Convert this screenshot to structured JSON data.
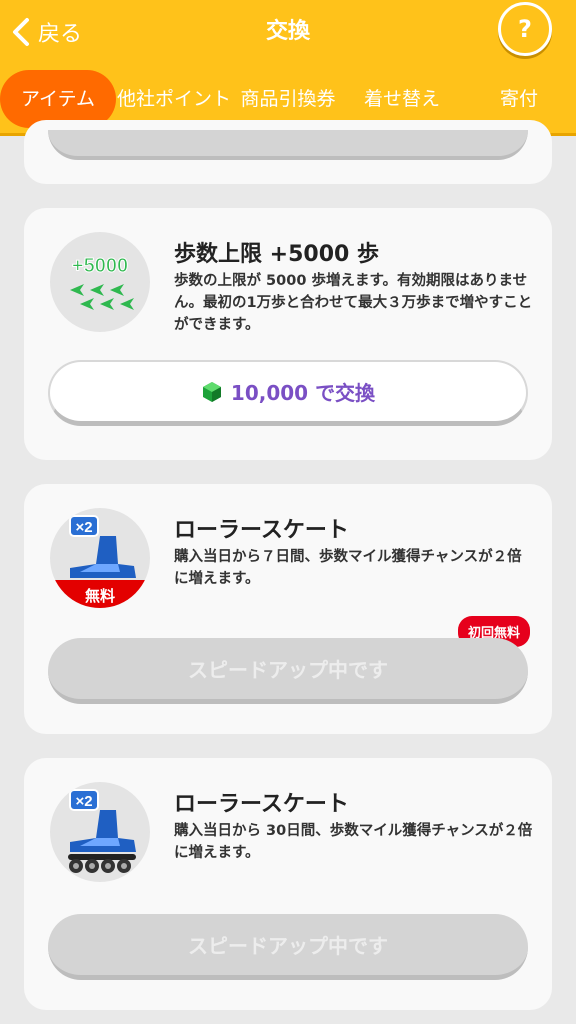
{
  "header": {
    "back_label": "戻る",
    "title": "交換",
    "help_label": "?",
    "brand_color": "#ffc21a",
    "active_tab_color": "#ff6a00"
  },
  "tabs": [
    {
      "label": "アイテム",
      "active": true
    },
    {
      "label": "他社ポイント",
      "active": false
    },
    {
      "label": "商品引換券",
      "active": false
    },
    {
      "label": "着せ替え",
      "active": false
    },
    {
      "label": "寄付",
      "active": false
    }
  ],
  "items": [
    {
      "title": "歩数上限 +5000 歩",
      "description": "歩数の上限が 5000 歩増えます。有効期限はありません。最初の1万歩と合わせて最大３万歩まで増やすことができます。",
      "icon_label": "+5000歩",
      "button_label": "10,000 で交換",
      "button_icon": "green-gem-icon"
    },
    {
      "title": "ローラースケート",
      "description": "購入当日から７日間、歩数マイル獲得チャンスが２倍に増えます。",
      "icon_multiplier": "×2",
      "icon_ribbon": "無料",
      "badge": "初回無料",
      "button_label": "スピードアップ中です"
    },
    {
      "title": "ローラースケート",
      "description": "購入当日から 30日間、歩数マイル獲得チャンスが２倍に増えます。",
      "icon_multiplier": "×2",
      "button_label": "スピードアップ中です"
    }
  ]
}
